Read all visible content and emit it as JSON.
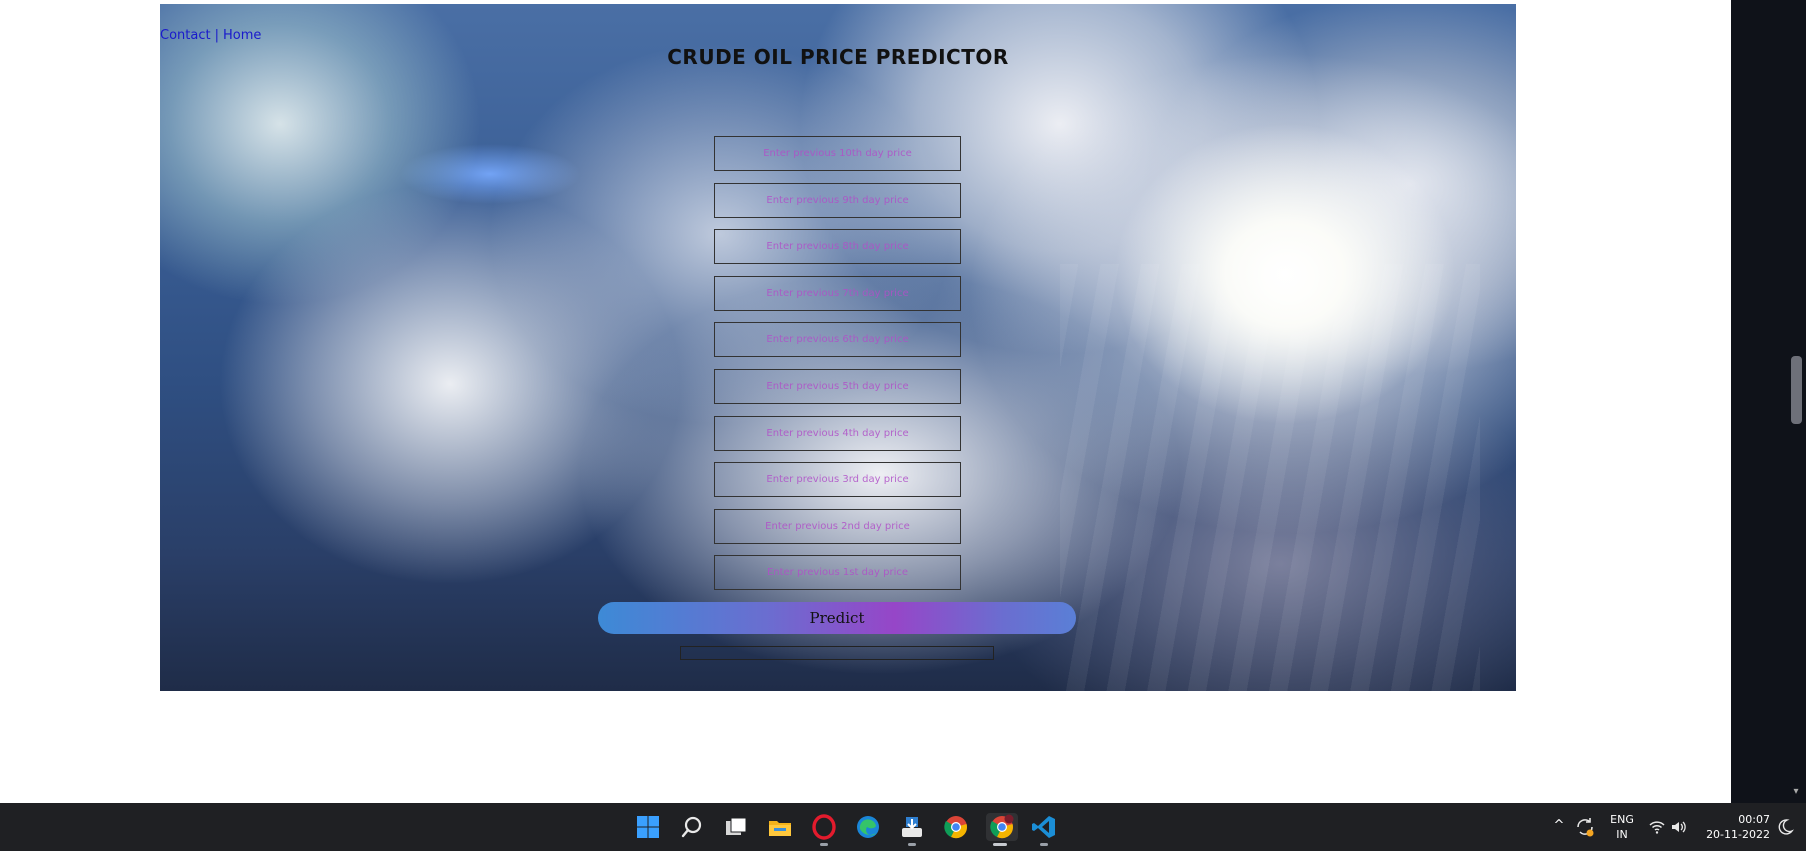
{
  "nav": {
    "contact": "Contact",
    "separator": "|",
    "home": "Home"
  },
  "page": {
    "title": "CRUDE OIL PRICE PREDICTOR"
  },
  "form": {
    "inputs": [
      {
        "placeholder": "Enter previous 10th day price"
      },
      {
        "placeholder": "Enter previous 9th day price"
      },
      {
        "placeholder": "Enter previous 8th day price"
      },
      {
        "placeholder": "Enter previous 7th day price"
      },
      {
        "placeholder": "Enter previous 6th day price"
      },
      {
        "placeholder": "Enter previous 5th day price"
      },
      {
        "placeholder": "Enter previous 4th day price"
      },
      {
        "placeholder": "Enter previous 3rd day price"
      },
      {
        "placeholder": "Enter previous 2nd day price"
      },
      {
        "placeholder": "Enter previous 1st day price"
      }
    ],
    "predict_label": "Predict",
    "result": ""
  },
  "taskbar": {
    "icons": [
      "windows-start-icon",
      "search-icon",
      "task-view-icon",
      "file-explorer-icon",
      "opera-icon",
      "edge-icon",
      "store-app-icon",
      "chrome-icon",
      "chrome-profile-icon",
      "vscode-icon"
    ]
  },
  "tray": {
    "language": "ENG",
    "region": "IN",
    "time": "00:07",
    "date": "20-11-2022"
  },
  "colors": {
    "nav_link": "#1a1acc",
    "placeholder": "#b050c8",
    "predict_gradient_start": "#3d8ad6",
    "predict_gradient_mid": "#9646c8",
    "taskbar": "#1f2023"
  }
}
